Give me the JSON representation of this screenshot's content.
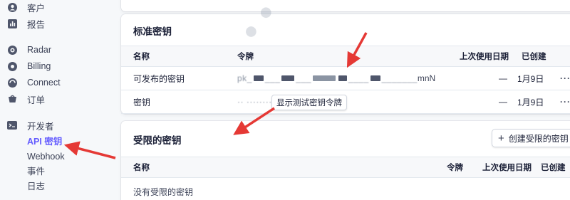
{
  "sidebar": {
    "items": [
      {
        "label": "客户",
        "icon": "customer-icon"
      },
      {
        "label": "报告",
        "icon": "report-icon"
      },
      {
        "label": "Radar",
        "icon": "radar-icon"
      },
      {
        "label": "Billing",
        "icon": "billing-icon"
      },
      {
        "label": "Connect",
        "icon": "connect-icon"
      },
      {
        "label": "订单",
        "icon": "orders-icon"
      },
      {
        "label": "开发者",
        "icon": "developer-icon"
      }
    ],
    "sub_items": [
      {
        "label": "API 密钥",
        "active": true
      },
      {
        "label": "Webhook"
      },
      {
        "label": "事件"
      },
      {
        "label": "日志"
      }
    ],
    "active_color": "#635bff"
  },
  "standard_keys": {
    "title": "标准密钥",
    "columns": {
      "name": "名称",
      "token": "令牌",
      "last_used": "上次使用日期",
      "created": "已创建"
    },
    "rows": [
      {
        "name": "可发布的密钥",
        "token_tail": "mnN",
        "last_used": "—",
        "created": "1月9日",
        "more": "···"
      },
      {
        "name": "密钥",
        "last_used": "—",
        "created": "1月9日",
        "more": "···"
      }
    ],
    "reveal_button": "显示测试密钥令牌"
  },
  "restricted_keys": {
    "title": "受限的密钥",
    "create_button": "创建受限的密钥",
    "columns": {
      "name": "名称",
      "token": "令牌",
      "last_used": "上次使用日期",
      "created": "已创建"
    },
    "empty_text": "没有受限的密钥"
  },
  "annotation_color": "#e53935"
}
